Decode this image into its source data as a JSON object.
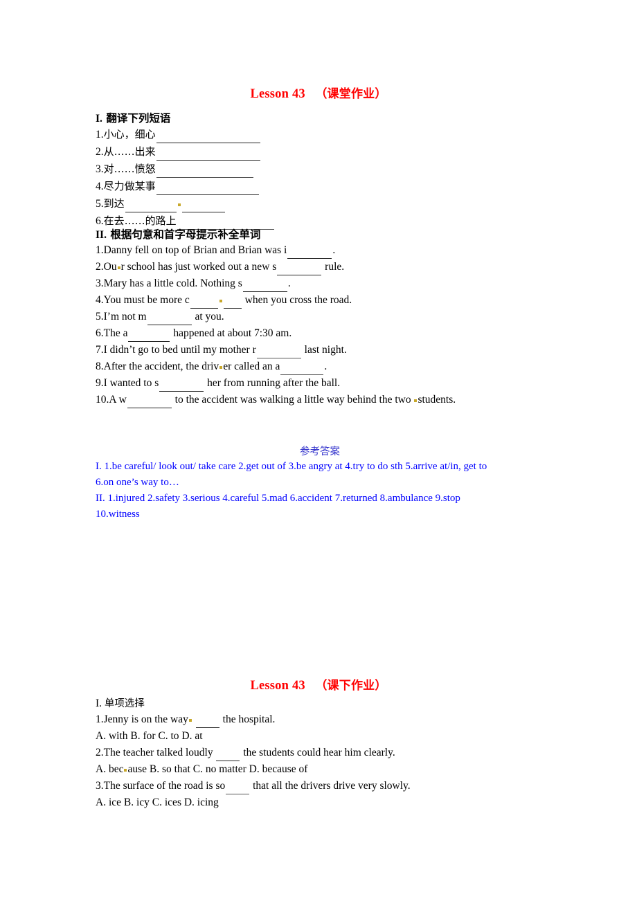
{
  "document": {
    "title_top": {
      "lesson": "Lesson 43",
      "paren": "（课堂作业）"
    },
    "title_bottom": {
      "lesson": "Lesson 43",
      "paren": "（课下作业）"
    },
    "colors": {
      "heading_red": "#ff0000",
      "answer_blue": "#0000ff",
      "answer_head_blue": "#3333cc",
      "mark_yellow": "#c8a82a",
      "text_black": "#000000"
    }
  },
  "section1": {
    "heading_roman": "I.",
    "heading_text": "翻译下列短语",
    "items": [
      {
        "num": "1.",
        "text": "小心，细心",
        "blank": 150
      },
      {
        "num": "2.",
        "text": "从……出来",
        "blank": 150
      },
      {
        "num": "3.",
        "text": "对……愤怒",
        "blank": 140
      },
      {
        "num": "4.",
        "text": "尽力做某事",
        "blank": 148
      },
      {
        "num": "5.",
        "text": "到达",
        "blank_a": 74,
        "blank_b": 62,
        "has_mark": true
      },
      {
        "num": "6.",
        "text": "在去……的路上",
        "blank": 140
      }
    ]
  },
  "section2": {
    "heading_roman": "II.",
    "heading_text": "根据句意和首字母提示补全单词",
    "items": [
      {
        "num": "1.",
        "pre": "Danny fell on top of Brian and Brian was i",
        "blank": 64,
        "post": "."
      },
      {
        "num": "2.",
        "pre": "Ou",
        "mark_after_pre": true,
        "pre2": "r school has just worked out a new s",
        "blank": 64,
        "post": " rule."
      },
      {
        "num": "3.",
        "pre": "Mary has a little cold. Nothing s",
        "blank": 64,
        "post": "."
      },
      {
        "num": "4.",
        "pre": "You must be more c",
        "blank_a": 40,
        "mark_mid": true,
        "blank_b": 26,
        "post": " when you cross the road."
      },
      {
        "num": "5.",
        "pre": "I’m not m",
        "blank": 64,
        "post": " at you."
      },
      {
        "num": "6.",
        "pre": "The a",
        "blank": 60,
        "post": " happened at about 7:30 am."
      },
      {
        "num": "7.",
        "pre": "I didn’t go to bed until my mother r",
        "blank": 64,
        "post": " last night.",
        "soft": true
      },
      {
        "num": "8.",
        "pre": "After the accident, the driv",
        "mark_after_pre": true,
        "pre2": "er called an a",
        "blank": 62,
        "post": ".",
        "soft": true
      },
      {
        "num": "9.",
        "pre": "I wanted to s",
        "blank": 64,
        "post": " her from running after the ball."
      },
      {
        "num": "10.",
        "pre": "A w",
        "blank": 64,
        "post": " to the accident was walking a little way behind the two ",
        "mark_end": true,
        "post2": "students."
      }
    ]
  },
  "answers": {
    "heading": "参考答案",
    "lines": [
      "I. 1.be careful/ look out/ take care 2.get out of 3.be angry at 4.try to do sth 5.arrive at/in, get to",
      "6.on one’s way to…",
      "II.  1.injured  2.safety  3.serious  4.careful  5.mad  6.accident  7.returned  8.ambulance  9.stop",
      "10.witness"
    ]
  },
  "section_bottom": {
    "heading_roman": "I.",
    "heading_text": "单项选择",
    "items": [
      {
        "num": "1.",
        "pre": "Jenny is on the way",
        "mark_after_pre": true,
        "pre2": " ",
        "blank": 34,
        "post": " the hospital."
      },
      {
        "options": "A. with B. for C. to D. at"
      },
      {
        "num": "2.",
        "pre": "The teacher talked loudly ",
        "blank": 34,
        "post": " the students could hear him clearly."
      },
      {
        "options": "A. bec",
        "options_mark": true,
        "options2": "ause B. so that C. no matter D. because of"
      },
      {
        "num": "3.",
        "pre": "The surface of the road is so",
        "blank": 34,
        "post": " that all the drivers drive very slowly.",
        "soft": true
      },
      {
        "options": "A. ice B. icy C. ices D. icing"
      }
    ]
  }
}
